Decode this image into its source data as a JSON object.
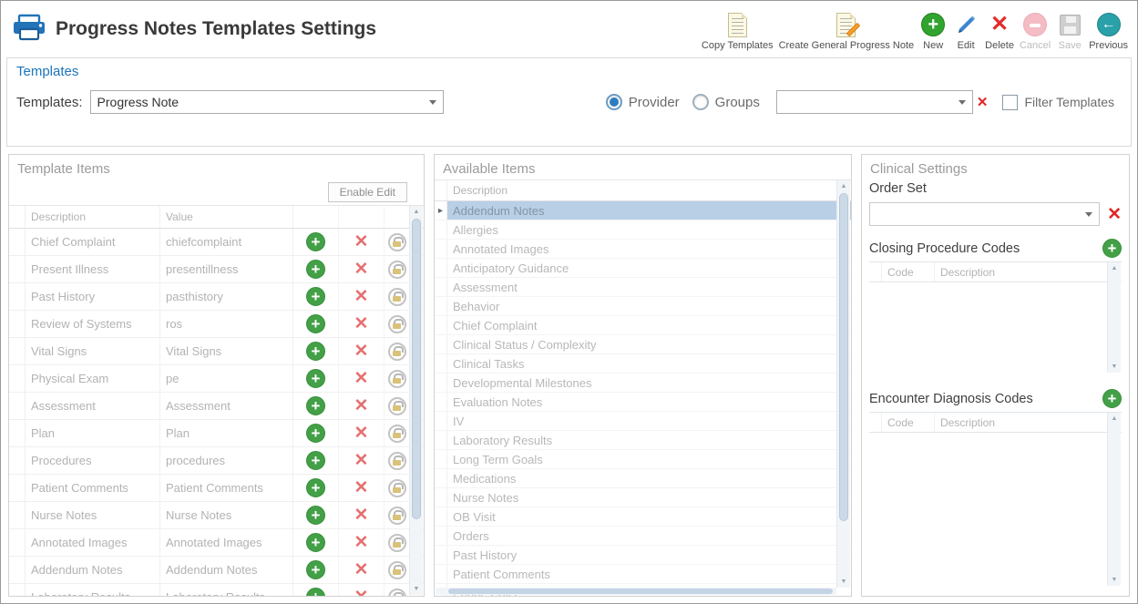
{
  "window": {
    "title": "Progress Notes Templates Settings"
  },
  "toolbar": {
    "items": [
      {
        "label": "Copy Templates",
        "enabled": true
      },
      {
        "label": "Create General Progress Note",
        "enabled": true
      },
      {
        "label": "New",
        "enabled": true
      },
      {
        "label": "Edit",
        "enabled": true
      },
      {
        "label": "Delete",
        "enabled": true
      },
      {
        "label": "Cancel",
        "enabled": false
      },
      {
        "label": "Save",
        "enabled": false
      },
      {
        "label": "Previous",
        "enabled": true
      }
    ]
  },
  "templates_section": {
    "heading": "Templates",
    "label": "Templates:",
    "selected_template": "Progress Note",
    "provider_label": "Provider",
    "groups_label": "Groups",
    "provider_selected": true,
    "groups_selected": false,
    "filter_value": "",
    "filter_checkbox_label": "Filter Templates",
    "filter_checked": false
  },
  "template_items": {
    "title": "Template Items",
    "enable_edit_label": "Enable Edit",
    "columns": {
      "description": "Description",
      "value": "Value"
    },
    "rows": [
      {
        "description": "Chief Complaint",
        "value": "chiefcomplaint"
      },
      {
        "description": "Present Illness",
        "value": "presentillness"
      },
      {
        "description": "Past History",
        "value": "pasthistory"
      },
      {
        "description": "Review of Systems",
        "value": "ros"
      },
      {
        "description": "Vital Signs",
        "value": "Vital Signs"
      },
      {
        "description": "Physical Exam",
        "value": "pe"
      },
      {
        "description": "Assessment",
        "value": "Assessment"
      },
      {
        "description": "Plan",
        "value": "Plan"
      },
      {
        "description": "Procedures",
        "value": "procedures"
      },
      {
        "description": "Patient Comments",
        "value": "Patient Comments"
      },
      {
        "description": "Nurse Notes",
        "value": "Nurse Notes"
      },
      {
        "description": "Annotated Images",
        "value": "Annotated Images"
      },
      {
        "description": "Addendum Notes",
        "value": "Addendum Notes"
      },
      {
        "description": "Laboratory Results",
        "value": "Laboratory Results"
      }
    ]
  },
  "available_items": {
    "title": "Available Items",
    "column_header": "Description",
    "selected_item": "Addendum Notes",
    "items": [
      "Addendum Notes",
      "Allergies",
      "Annotated Images",
      "Anticipatory Guidance",
      "Assessment",
      "Behavior",
      "Chief Complaint",
      "Clinical Status / Complexity",
      "Clinical Tasks",
      "Developmental Milestones",
      "Evaluation Notes",
      "IV",
      "Laboratory Results",
      "Long Term Goals",
      "Medications",
      "Nurse Notes",
      "OB Visit",
      "Orders",
      "Past History",
      "Patient Comments",
      "Phone Calls"
    ]
  },
  "clinical_settings": {
    "title": "Clinical Settings",
    "order_set_label": "Order Set",
    "order_set_value": "",
    "closing_codes_label": "Closing Procedure Codes",
    "encounter_codes_label": "Encounter Diagnosis Codes",
    "codes_columns": {
      "code": "Code",
      "description": "Description"
    },
    "closing_codes_rows": [],
    "encounter_codes_rows": []
  },
  "colors": {
    "accent_blue": "#1b75bb",
    "action_green": "#43a047",
    "action_red": "#e05c5c",
    "previous_teal": "#2aa0a8",
    "selected_row": "#b9cfe6"
  }
}
